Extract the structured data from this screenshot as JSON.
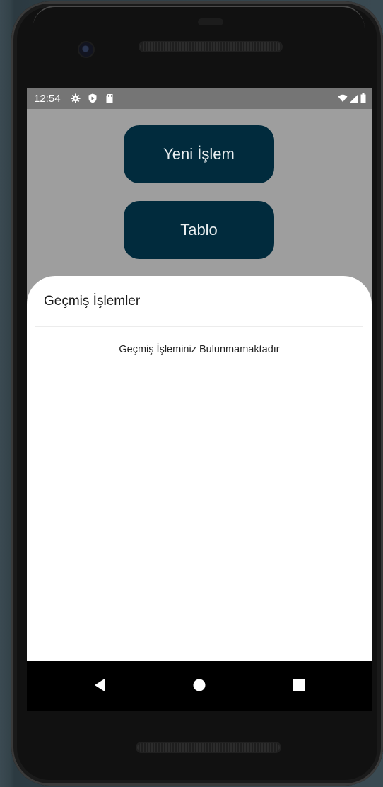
{
  "status_bar": {
    "time": "12:54",
    "left_icons": [
      "gear-icon",
      "shield-icon",
      "sd-card-icon"
    ],
    "right_icons": [
      "wifi-icon",
      "signal-icon",
      "battery-icon"
    ],
    "background": "#757575"
  },
  "app": {
    "background": "#9e9e9e",
    "buttons": [
      {
        "label": "Yeni İşlem"
      },
      {
        "label": "Tablo"
      }
    ],
    "button_color": "#012b3d"
  },
  "bottom_sheet": {
    "title": "Geçmiş İşlemler",
    "empty_message": "Geçmiş İşleminiz Bulunmamaktadır"
  },
  "nav_bar": {
    "buttons": [
      "back-icon",
      "home-icon",
      "recents-icon"
    ]
  }
}
